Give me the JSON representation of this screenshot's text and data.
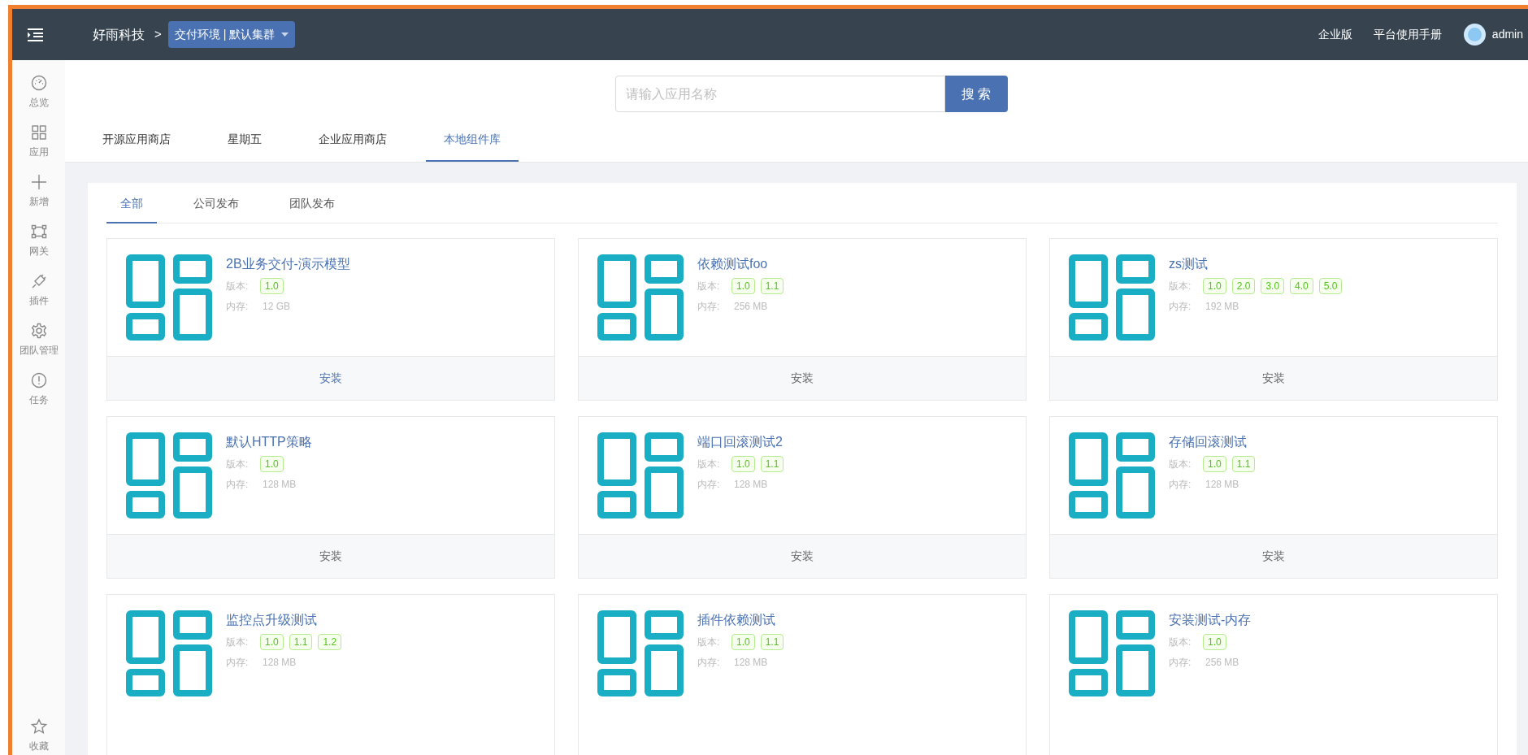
{
  "topbar": {
    "brand": "好雨科技",
    "separator": ">",
    "env_dropdown": "交付环境 | 默认集群",
    "links": [
      "企业版",
      "平台使用手册"
    ],
    "user": "admin"
  },
  "sidebar": {
    "items": [
      {
        "kind": "gauge",
        "label": "总览"
      },
      {
        "kind": "grid",
        "label": "应用"
      },
      {
        "kind": "plus",
        "label": "新增"
      },
      {
        "kind": "gateway",
        "label": "网关"
      },
      {
        "kind": "plug",
        "label": "插件"
      },
      {
        "kind": "gear",
        "label": "团队管理"
      },
      {
        "kind": "alert",
        "label": "任务"
      }
    ],
    "bottom": [
      {
        "kind": "star",
        "label": "收藏"
      }
    ]
  },
  "search": {
    "placeholder": "请输入应用名称",
    "button": "搜 索"
  },
  "store_tabs": [
    {
      "label": "开源应用商店",
      "selected": false
    },
    {
      "label": "星期五",
      "selected": false
    },
    {
      "label": "企业应用商店",
      "selected": false
    },
    {
      "label": "本地组件库",
      "selected": true
    }
  ],
  "filter_tabs": [
    {
      "label": "全部",
      "selected": true
    },
    {
      "label": "公司发布",
      "selected": false
    },
    {
      "label": "团队发布",
      "selected": false
    }
  ],
  "apps": [
    {
      "name": "2B业务交付-演示模型",
      "version_label": "版本:",
      "versions": [
        "1.0"
      ],
      "memory_label": "内存:",
      "memory": "12 GB",
      "install": "安装",
      "hovered": true
    },
    {
      "name": "依赖测试foo",
      "version_label": "版本:",
      "versions": [
        "1.0",
        "1.1"
      ],
      "memory_label": "内存:",
      "memory": "256 MB",
      "install": "安装",
      "hovered": false
    },
    {
      "name": "zs测试",
      "version_label": "版本:",
      "versions": [
        "1.0",
        "2.0",
        "3.0",
        "4.0",
        "5.0"
      ],
      "memory_label": "内存:",
      "memory": "192 MB",
      "install": "安装",
      "hovered": false
    },
    {
      "name": "默认HTTP策略",
      "version_label": "版本:",
      "versions": [
        "1.0"
      ],
      "memory_label": "内存:",
      "memory": "128 MB",
      "install": "安装",
      "hovered": false
    },
    {
      "name": "端口回滚测试2",
      "version_label": "版本:",
      "versions": [
        "1.0",
        "1.1"
      ],
      "memory_label": "内存:",
      "memory": "128 MB",
      "install": "安装",
      "hovered": false
    },
    {
      "name": "存储回滚测试",
      "version_label": "版本:",
      "versions": [
        "1.0",
        "1.1"
      ],
      "memory_label": "内存:",
      "memory": "128 MB",
      "install": "安装",
      "hovered": false
    },
    {
      "name": "监控点升级测试",
      "version_label": "版本:",
      "versions": [
        "1.0",
        "1.1",
        "1.2"
      ],
      "memory_label": "内存:",
      "memory": "128 MB"
    },
    {
      "name": "插件依赖测试",
      "version_label": "版本:",
      "versions": [
        "1.0",
        "1.1"
      ],
      "memory_label": "内存:",
      "memory": "128 MB"
    },
    {
      "name": "安装测试-内存",
      "version_label": "版本:",
      "versions": [
        "1.0"
      ],
      "memory_label": "内存:",
      "memory": "256 MB"
    }
  ]
}
